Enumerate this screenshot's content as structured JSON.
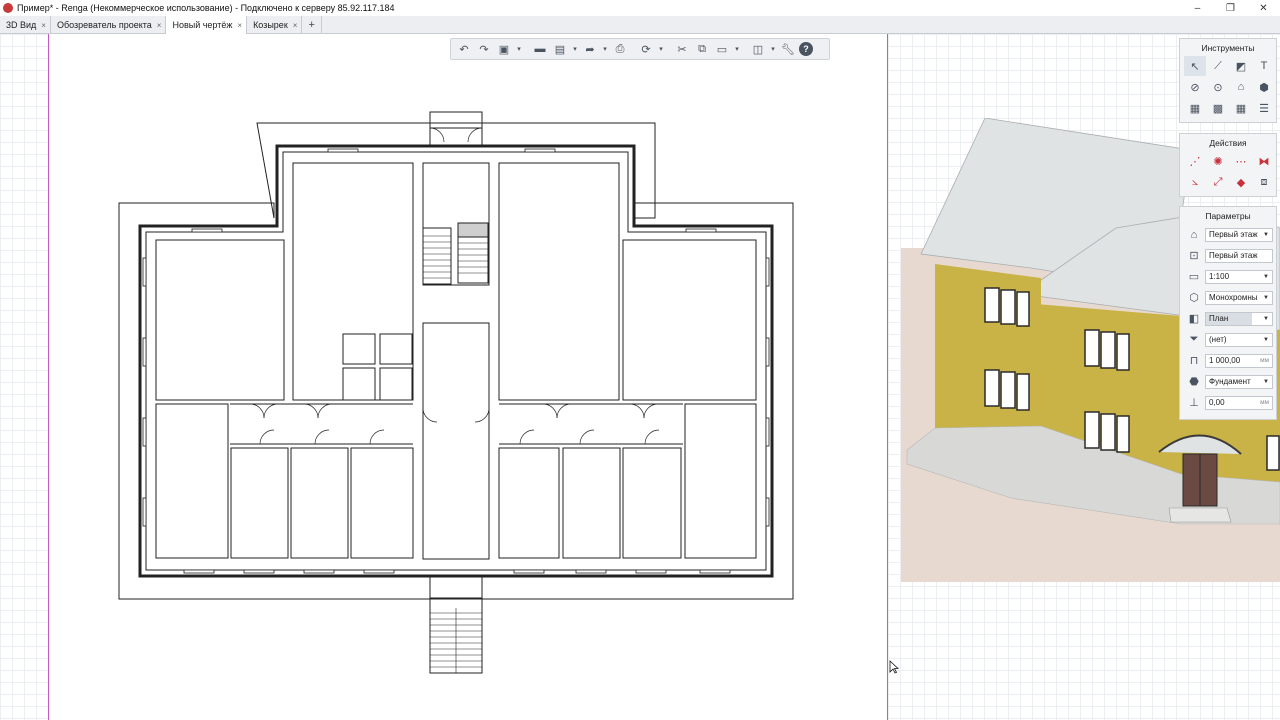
{
  "window": {
    "title": "Пример* - Renga (Некоммерческое использование) - Подключено к серверу 85.92.117.184",
    "minimize": "–",
    "restore": "❐",
    "close": "✕"
  },
  "tabs": [
    {
      "label": "3D Вид",
      "close": "×"
    },
    {
      "label": "Обозреватель проекта",
      "close": "×"
    },
    {
      "label": "Новый чертёж",
      "close": "×"
    },
    {
      "label": "Козырек",
      "close": "×"
    }
  ],
  "tab_add": "+",
  "toolbar": {
    "icons": [
      "undo-icon",
      "redo-icon",
      "cube-icon",
      "open-folder-icon",
      "save-icon",
      "export-icon",
      "print-icon",
      "orbit-icon",
      "cut-icon",
      "copy-icon",
      "paste-icon",
      "layers-icon",
      "wrench-icon",
      "help-icon"
    ],
    "help": "?"
  },
  "tools_panel": {
    "title": "Инструменты",
    "icons": [
      "select-icon",
      "line-icon",
      "hatch-icon",
      "text-icon",
      "dimension-icon",
      "level-mark-icon",
      "axis-icon",
      "view-icon",
      "stamp-icon",
      "table-icon",
      "grid-table-icon",
      "list-icon"
    ]
  },
  "actions_panel": {
    "title": "Действия",
    "icons": [
      "move-icon",
      "rotate-icon",
      "copy-array-icon",
      "mirror-icon",
      "angle-icon",
      "scale-icon",
      "delete-icon",
      "reference-icon"
    ]
  },
  "params_panel": {
    "title": "Параметры",
    "rows": [
      {
        "icon": "level-icon",
        "value": "Первый этаж",
        "dropdown": true
      },
      {
        "icon": "name-icon",
        "value": "Первый этаж",
        "dropdown": false
      },
      {
        "icon": "scale-ruler-icon",
        "value": "1:100",
        "dropdown": true
      },
      {
        "icon": "style-icon",
        "value": "Монохромны",
        "dropdown": true
      },
      {
        "icon": "plan-icon",
        "value": "План",
        "dropdown": true
      },
      {
        "icon": "filter-icon",
        "value": "(нет)",
        "dropdown": true
      },
      {
        "icon": "elevation-icon",
        "value": "1 000,00",
        "unit": "мм"
      },
      {
        "icon": "cut-level-icon",
        "value": "Фундамент",
        "dropdown": true
      },
      {
        "icon": "depth-icon",
        "value": "0,00",
        "unit": "мм"
      }
    ]
  },
  "colors": {
    "sheet_border": "#c35bc3",
    "roof": "#dfe3e3",
    "brick": "#c9b246",
    "plinth": "#d8d8d6",
    "ground": "#e8d9d0",
    "door": "#6a4a42"
  }
}
